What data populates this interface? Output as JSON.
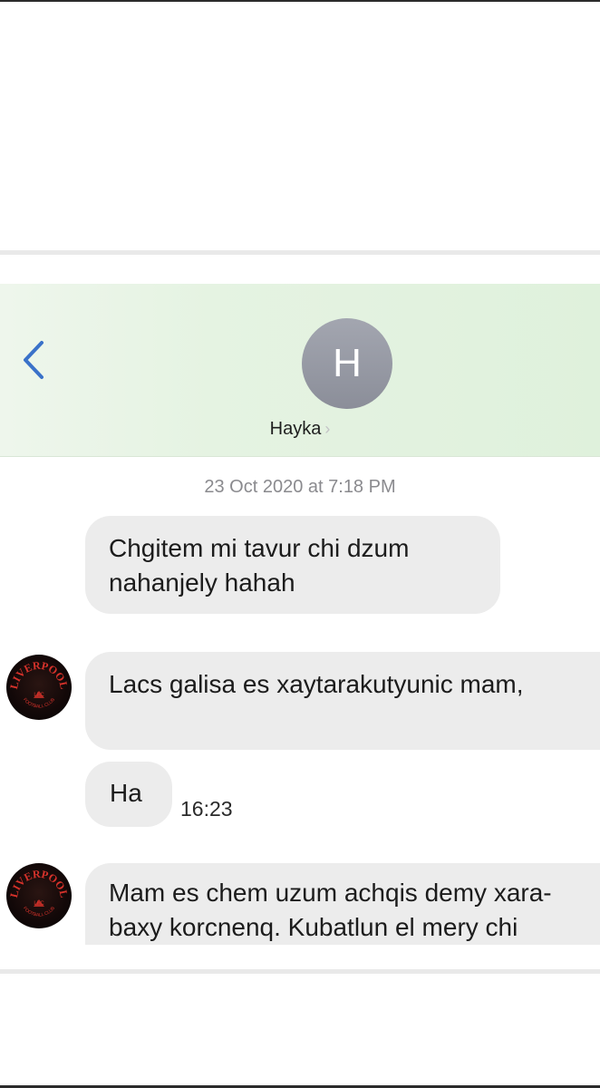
{
  "conversation": {
    "contact": {
      "initial": "H",
      "name": "Hayka",
      "chevron": "›"
    },
    "back_icon": "chevron-left-icon",
    "timestamp": "23 Oct 2020 at 7:18 PM",
    "messages": [
      {
        "text": "Chgitem mi tavur chi dzum nahanjely hahah"
      },
      {
        "text": "Lacs galisa es xaytarakutyunic mam,"
      },
      {
        "text": "Ha",
        "time": "16:23"
      },
      {
        "text": "Mam es chem uzum achqis demy xara-baxy korcnenq. Kubatlun el mery chi"
      }
    ],
    "avatar_logo": {
      "arc_text": "LIVERPOOL",
      "sub_text": "FOOTBALL CLUB",
      "small": "LFC"
    }
  },
  "colors": {
    "header_bg": "#e2f2df",
    "bubble_bg": "#ececec",
    "link_blue": "#3a72c9",
    "avatar_gray": "#9a9da8",
    "logo_red": "#d6322b"
  }
}
